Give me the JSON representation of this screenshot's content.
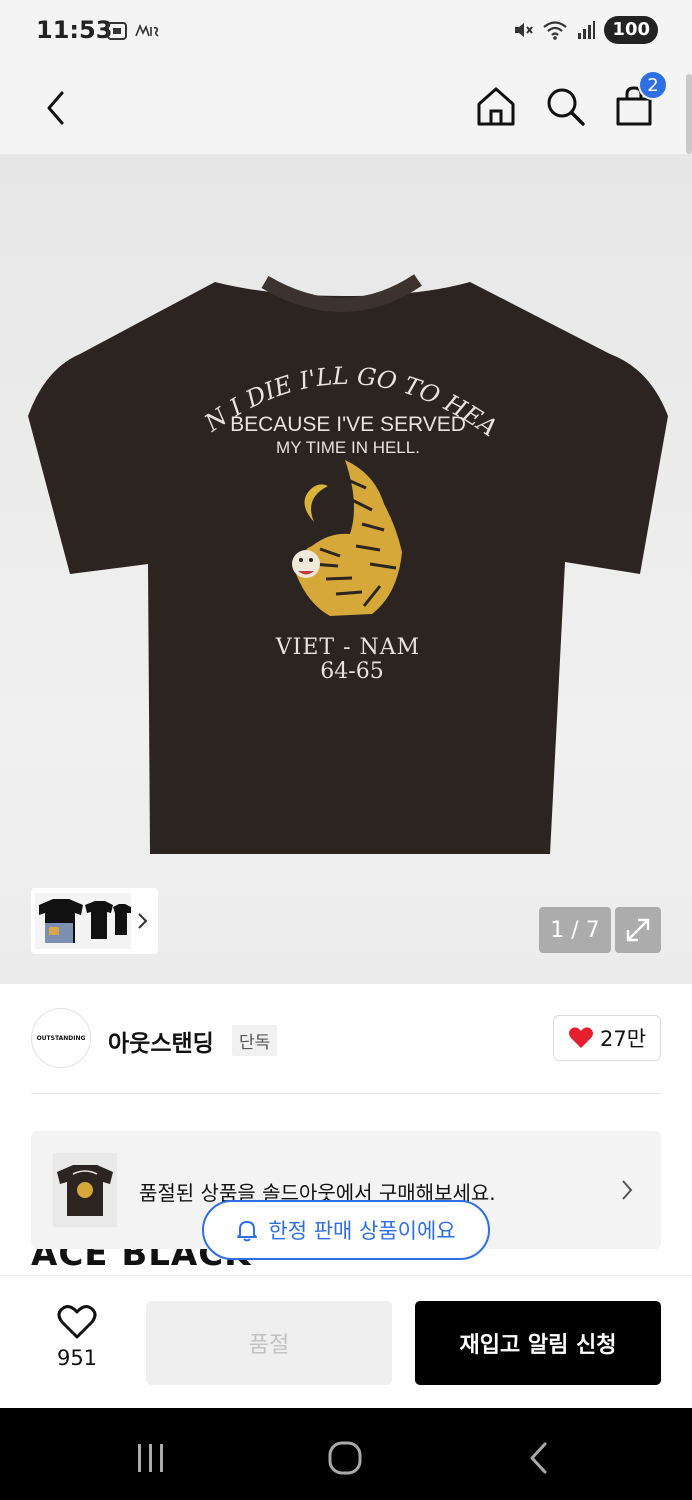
{
  "status_bar": {
    "time": "11:53",
    "battery": "100",
    "icons": [
      "screenshot-icon",
      "app-notification-icon",
      "mute-icon",
      "wifi-icon",
      "signal-icon"
    ]
  },
  "top_bar": {
    "icons": [
      "back-icon",
      "home-icon",
      "search-icon",
      "cart-icon"
    ],
    "cart_count": "2"
  },
  "hero": {
    "print": {
      "arc_line": "WHEN I DIE I'LL GO TO HEAVEN",
      "line2": "BECAUSE I'VE SERVED",
      "line3": "MY TIME IN HELL.",
      "line4": "VIET - NAM",
      "line5": "64-65"
    },
    "page_counter": "1 / 7",
    "shirt_color": "#2b2421"
  },
  "brand": {
    "logo_text": "OUTSTANDING",
    "name": "아웃스탠딩",
    "tag": "단독",
    "likes": "27만"
  },
  "product": {
    "title_partial": "ACE BLACK"
  },
  "soldout_card": {
    "text": "품절된 상품을 솔드아웃에서 구매해보세요."
  },
  "limited_pill": {
    "text": "한정 판매 상품이에요"
  },
  "bottom_bar": {
    "wish_count": "951",
    "soldout_label": "품절",
    "restock_label": "재입고 알림 신청"
  },
  "colors": {
    "accent_blue": "#2f6fe4",
    "heart_red": "#e5202e",
    "black": "#000000"
  }
}
